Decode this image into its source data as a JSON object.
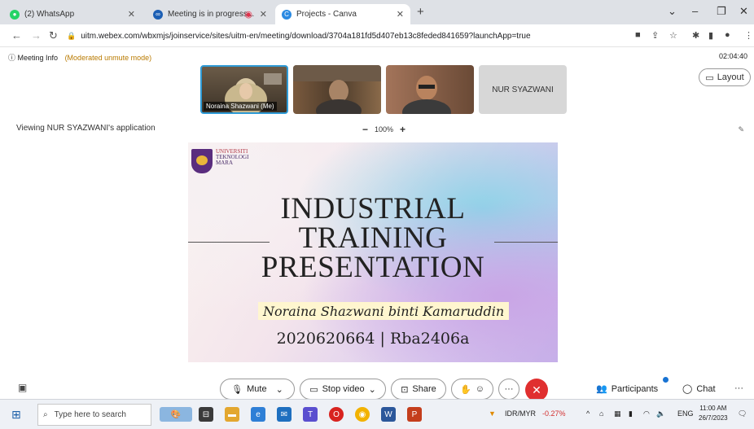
{
  "browser": {
    "tabs": [
      {
        "label": "(2) WhatsApp",
        "fav_color": "#25d366"
      },
      {
        "label": "Meeting is in progress...",
        "fav_color": "#1c5fb4"
      },
      {
        "label": "Projects - Canva",
        "fav_color": "#2b8ae2"
      }
    ],
    "new_tab": "+",
    "url": "uitm.webex.com/wbxmjs/joinservice/sites/uitm-en/meeting/download/3704a181fd5d407eb13c8feded841659?launchApp=true"
  },
  "meeting": {
    "info_label": "Meeting Info",
    "unmute_mode": "(Moderated unmute mode)",
    "clock": "02:04:40",
    "layout_label": "Layout",
    "participants_thumbs": [
      {
        "name": "Noraina Shazwani (Me)"
      },
      {
        "name": ""
      },
      {
        "name": ""
      },
      {
        "name": "NUR SYAZWANI"
      }
    ],
    "viewing_label": "Viewing NUR SYAZWANI's application",
    "zoom_minus": "−",
    "zoom_level": "100%",
    "zoom_plus": "+"
  },
  "slide": {
    "logo_line1": "UNIVERSITI",
    "logo_line2": "TEKNOLOGI",
    "logo_line3": "MARA",
    "title_line1": "INDUSTRIAL",
    "title_line2": "TRAINING",
    "title_line3": "PRESENTATION",
    "presenter": "Noraina Shazwani binti Kamaruddin",
    "id_line": "2020620664 | Rba2406a"
  },
  "controls": {
    "mute": "Mute",
    "stop_video": "Stop video",
    "share": "Share",
    "more": "···",
    "participants": "Participants",
    "chat": "Chat",
    "overflow": "···"
  },
  "taskbar": {
    "search_placeholder": "Type here to search",
    "currency": "IDR/MYR",
    "currency_change": "-0.27%",
    "lang": "ENG",
    "time": "11:00 AM",
    "date": "26/7/2023"
  }
}
